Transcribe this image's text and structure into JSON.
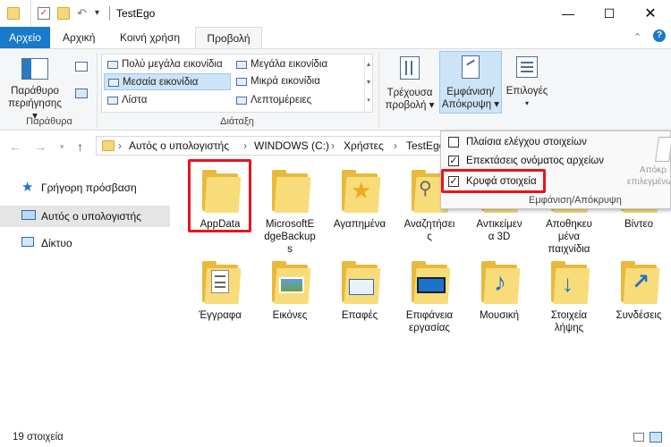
{
  "window": {
    "title": "TestEgo"
  },
  "tabs": [
    "Αρχείο",
    "Αρχική",
    "Κοινή χρήση",
    "Προβολή"
  ],
  "ribbon": {
    "panes": {
      "button_label_1": "Παράθυρο",
      "button_label_2": "περιήγησης ▾",
      "group_label": "Παράθυρα"
    },
    "layout": {
      "items": [
        "Πολύ μεγάλα εικονίδια",
        "Μεγάλα εικονίδια",
        "Μεσαία εικονίδια",
        "Μικρά εικονίδια",
        "Λίστα",
        "Λεπτομέρειες"
      ],
      "selected": "Μεσαία εικονίδια",
      "group_label": "Διάταξη"
    },
    "current_view": {
      "label_1": "Τρέχουσα",
      "label_2": "προβολή ▾"
    },
    "show_hide": {
      "label_1": "Εμφάνιση/",
      "label_2": "Απόκρυψη ▾"
    },
    "options": {
      "label": "Επιλογές"
    }
  },
  "show_hide_menu": {
    "item_checkboxes": {
      "label": "Πλαίσια ελέγχου στοιχείων",
      "checked": false
    },
    "file_extensions": {
      "label": "Επεκτάσεις ονόματος αρχείων",
      "checked": true
    },
    "hidden_items": {
      "label": "Κρυφά στοιχεία",
      "checked": true
    },
    "hide_selected_1": "Απόκρ",
    "hide_selected_2": "επιλεγμένων",
    "group_label": "Εμφάνιση/Απόκρυψη"
  },
  "address": {
    "crumbs": [
      "Αυτός ο υπολογιστής",
      "WINDOWS (C:)",
      "Χρήστες",
      "TestEgo"
    ]
  },
  "nav": {
    "quick_access": "Γρήγορη πρόσβαση",
    "this_pc": "Αυτός ο υπολογιστής",
    "network": "Δίκτυο"
  },
  "files": {
    "row1": [
      {
        "name": "AppData",
        "icon": "folder-icon"
      },
      {
        "name": "MicrosoftE\ndgeBackup\ns",
        "icon": "folder-icon"
      },
      {
        "name": "Αγαπημένα",
        "icon": "favorites-folder-icon"
      },
      {
        "name": "Αναζητήσει\nς",
        "icon": "searches-folder-icon"
      },
      {
        "name": "Αντικείμεν\nα 3D",
        "icon": "3d-objects-folder-icon"
      },
      {
        "name": "Αποθηκευ\nμένα\nπαιχνίδια",
        "icon": "saved-games-folder-icon"
      },
      {
        "name": "Βίντεο",
        "icon": "videos-folder-icon"
      }
    ],
    "row2": [
      {
        "name": "Έγγραφα",
        "icon": "documents-folder-icon"
      },
      {
        "name": "Εικόνες",
        "icon": "pictures-folder-icon"
      },
      {
        "name": "Επαφές",
        "icon": "contacts-folder-icon"
      },
      {
        "name": "Επιφάνεια\nεργασίας",
        "icon": "desktop-folder-icon"
      },
      {
        "name": "Μουσική",
        "icon": "music-folder-icon"
      },
      {
        "name": "Στοιχεία\nλήψης",
        "icon": "downloads-folder-icon"
      },
      {
        "name": "Συνδέσεις",
        "icon": "links-folder-icon"
      }
    ]
  },
  "status": {
    "count": "19 στοιχεία"
  },
  "colors": {
    "file_tab": "#1979ca",
    "highlight": "#e8141e",
    "selected": "#cce4f7"
  }
}
